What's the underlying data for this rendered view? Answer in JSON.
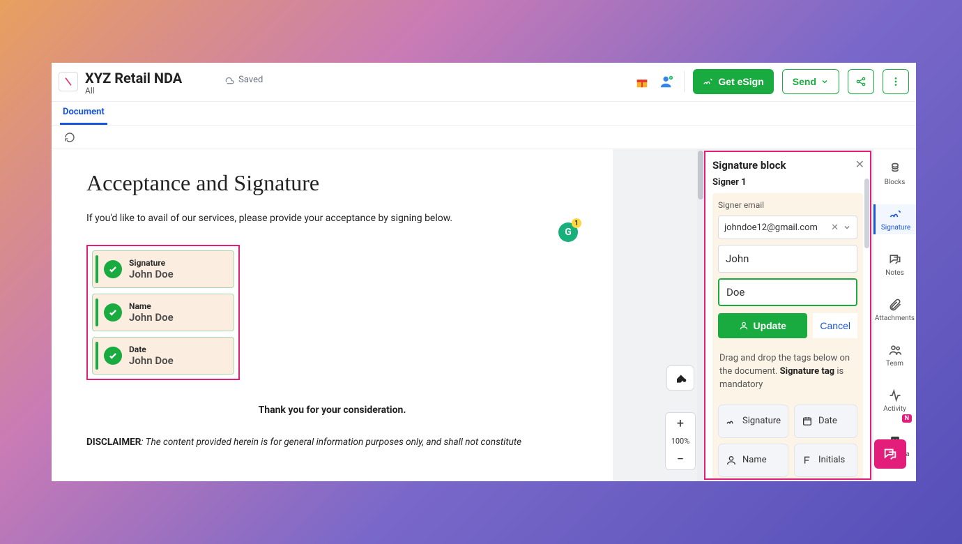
{
  "header": {
    "title": "XYZ Retail NDA",
    "subtitle": "All",
    "saved_label": "Saved"
  },
  "actions": {
    "get_esign": "Get eSign",
    "send": "Send"
  },
  "tabs": {
    "document": "Document"
  },
  "zoom": {
    "percent": "100%"
  },
  "document": {
    "heading": "Acceptance and Signature",
    "intro": "If you'd like to avail of our services, please provide your acceptance by signing below.",
    "thanks": "Thank you for your consideration.",
    "disclaimer_label": "DISCLAIMER",
    "disclaimer_text": ": The content provided herein is for general information purposes only, and shall not constitute",
    "blocks": [
      {
        "label": "Signature",
        "value": "John Doe"
      },
      {
        "label": "Name",
        "value": "John Doe"
      },
      {
        "label": "Date",
        "value": "John Doe"
      }
    ]
  },
  "panel": {
    "title": "Signature block",
    "signer_label": "Signer 1",
    "email_label": "Signer email",
    "email_value": "johndoe12@gmail.com",
    "first_name": "John",
    "last_name": "Doe",
    "update": "Update",
    "cancel": "Cancel",
    "help_pre": "Drag and drop the tags below on the document. ",
    "help_bold": "Signature tag",
    "help_post": " is mandatory",
    "tags": {
      "signature": "Signature",
      "date": "Date",
      "name": "Name",
      "initials": "Initials"
    }
  },
  "rail": {
    "blocks": "Blocks",
    "signature": "Signature",
    "notes": "Notes",
    "attachments": "Attachments",
    "team": "Team",
    "activity": "Activity",
    "metadata": "Metadata",
    "new_badge": "N"
  }
}
